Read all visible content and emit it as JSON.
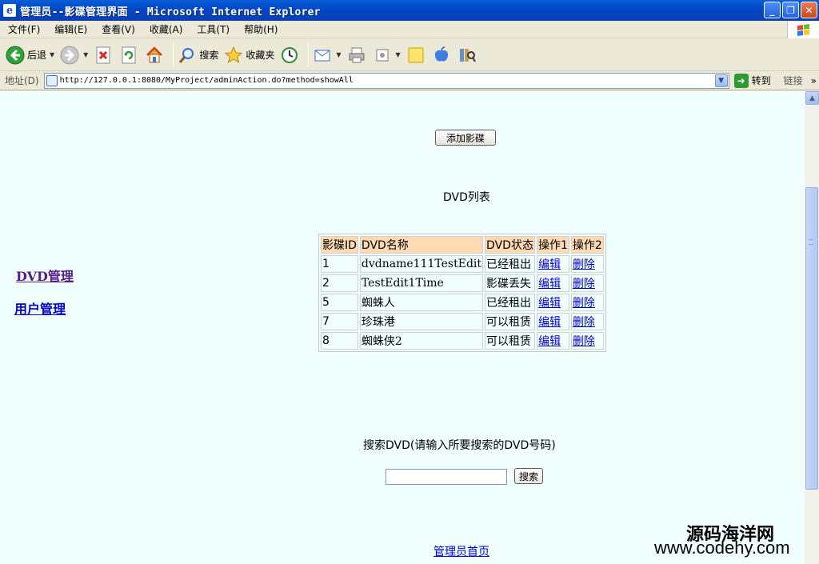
{
  "window": {
    "title": "管理员--影碟管理界面 - Microsoft Internet Explorer",
    "app_icon_glyph": "e",
    "minimize": "_",
    "maximize": "❐",
    "close": "✕"
  },
  "menu": {
    "items": [
      "文件(F)",
      "编辑(E)",
      "查看(V)",
      "收藏(A)",
      "工具(T)",
      "帮助(H)"
    ]
  },
  "toolbar": {
    "back_label": "后退",
    "search_label": "搜索",
    "favorites_label": "收藏夹"
  },
  "address": {
    "label": "地址(D)",
    "url": "http://127.0.0.1:8080/MyProject/adminAction.do?method=showAll",
    "go_label": "转到",
    "links_label": "链接",
    "links_arrow": "»"
  },
  "page": {
    "add_button": "添加影碟",
    "list_title": "DVD列表",
    "sidebar": {
      "dvd_manage": "DVD管理",
      "user_manage": "用户管理"
    },
    "table": {
      "headers": [
        "影碟ID",
        "DVD名称",
        "DVD状态",
        "操作1",
        "操作2"
      ],
      "rows": [
        {
          "id": "1",
          "name": "dvdname111TestEdit",
          "status": "已经租出",
          "op1": "编辑",
          "op2": "删除"
        },
        {
          "id": "2",
          "name": "TestEdit1Time",
          "status": "影碟丢失",
          "op1": "编辑",
          "op2": "删除"
        },
        {
          "id": "5",
          "name": "蜘蛛人",
          "status": "已经租出",
          "op1": "编辑",
          "op2": "删除"
        },
        {
          "id": "7",
          "name": "珍珠港",
          "status": "可以租赁",
          "op1": "编辑",
          "op2": "删除"
        },
        {
          "id": "8",
          "name": "蜘蛛侠2",
          "status": "可以租赁",
          "op1": "编辑",
          "op2": "删除"
        }
      ]
    },
    "search": {
      "label": "搜索DVD(请输入所要搜索的DVD号码)",
      "value": "",
      "button": "搜索"
    },
    "home_link": "管理员首页"
  },
  "watermark": {
    "line1": "源码海洋网",
    "line2": "www.codehy.com"
  },
  "colors": {
    "content_bg": "#f0fefe",
    "table_header_bg": "#ffdab3",
    "link": "#0000cc",
    "visited_link": "#551a8b",
    "titlebar": "#0046c8"
  }
}
